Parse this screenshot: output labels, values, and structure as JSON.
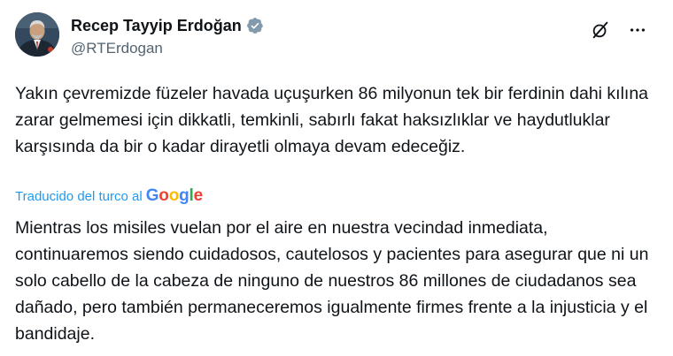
{
  "author": {
    "display_name": "Recep Tayyip Erdoğan",
    "handle": "@RTErdogan",
    "verified": true,
    "verified_badge_color": "#829aab"
  },
  "actions": {
    "grok_icon": "grok-slash-icon",
    "more_icon": "more-dots-icon"
  },
  "tweet": {
    "original_text": "Yakın çevremizde füzeler havada uçuşurken 86 milyonun tek bir ferdinin dahi kılına zarar gelmemesi için dikkatli, temkinli, sabırlı fakat haksızlıklar ve haydutluklar karşısında da bir o kadar dirayetli olmaya devam edeceğiz.",
    "translated_by_label": "Traducido del turco al",
    "translator_brand": "Google",
    "translated_text": "Mientras los misiles vuelan por el aire en nuestra vecindad inmediata, continuaremos siendo cuidadosos, cautelosos y pacientes para asegurar que ni un solo cabello de la cabeza de ninguno de nuestros 86 millones de ciudadanos sea dañado, pero también permaneceremos igualmente firmes frente a la injusticia y el bandidaje."
  },
  "colors": {
    "text_primary": "#0f1419",
    "text_secondary": "#536471",
    "link_blue": "#1d9bf0",
    "google_blue": "#4285f4",
    "google_red": "#ea4335",
    "google_yellow": "#fbbc05",
    "google_green": "#34a853"
  }
}
